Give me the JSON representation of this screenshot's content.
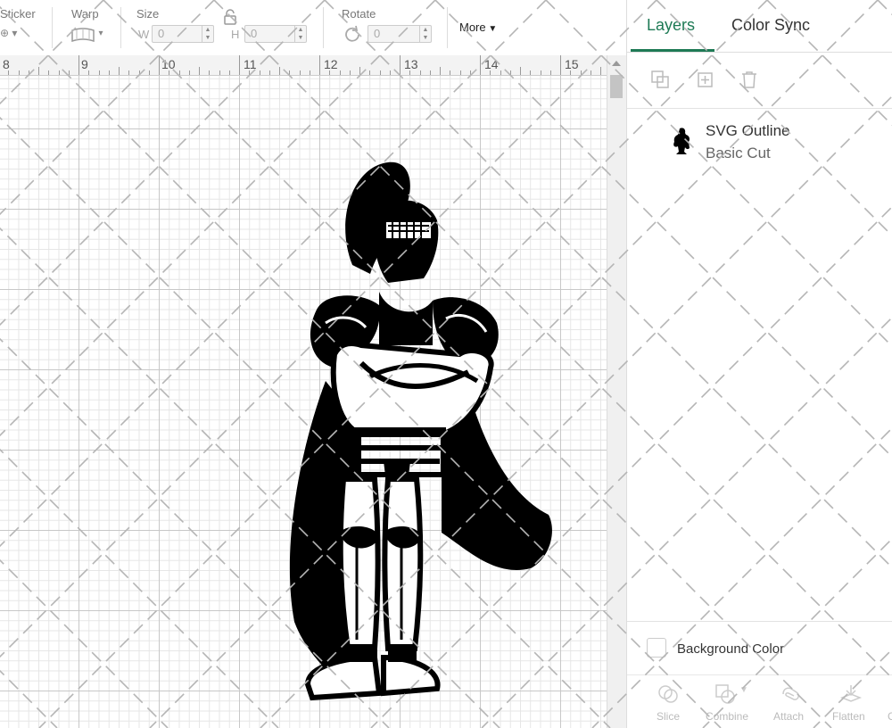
{
  "toolbar": {
    "sticker_label": "Sticker",
    "warp_label": "Warp",
    "size_label": "Size",
    "width_prefix": "W",
    "width_value": "0",
    "height_prefix": "H",
    "height_value": "0",
    "rotate_label": "Rotate",
    "rotate_value": "0",
    "more_label": "More"
  },
  "ruler": {
    "numbers": [
      "8",
      "9",
      "10",
      "11",
      "12",
      "13",
      "14",
      "15"
    ]
  },
  "panel": {
    "tabs": [
      {
        "label": "Layers",
        "active": true
      },
      {
        "label": "Color Sync",
        "active": false
      }
    ],
    "layer": {
      "name": "SVG Outline",
      "operation": "Basic Cut",
      "thumbnail_icon": "knight-thumbnail-icon"
    },
    "background_color_label": "Background Color",
    "bottom_actions": [
      "Slice",
      "Combine",
      "Attach",
      "Flatten",
      "C"
    ],
    "accent_color": "#1e7a55"
  },
  "canvas": {
    "artwork_icon": "knight-silhouette-icon"
  }
}
